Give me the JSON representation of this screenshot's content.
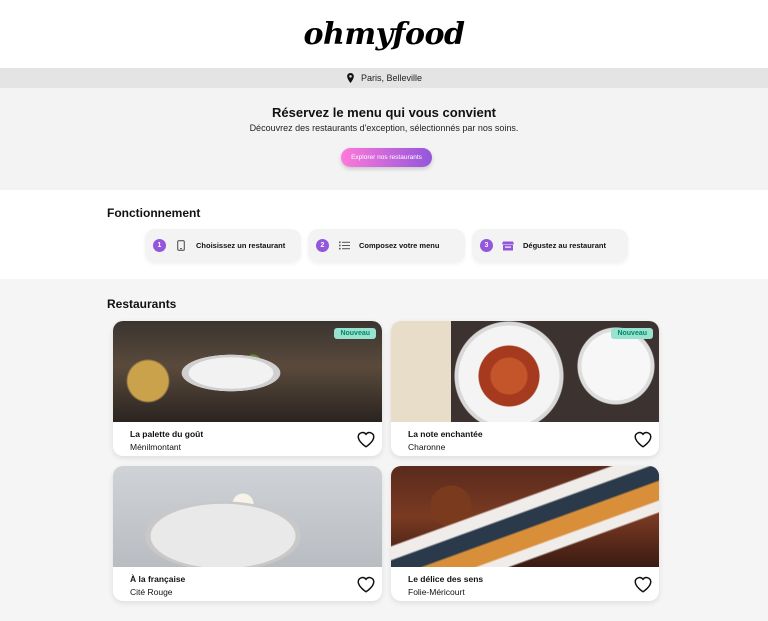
{
  "header": {
    "logo_text": "ohmyfood"
  },
  "location": {
    "icon": "map-pin-icon",
    "text": "Paris, Belleville"
  },
  "hero": {
    "title": "Réservez le menu qui vous convient",
    "subtitle": "Découvrez des restaurants d'exception, sélectionnés par nos soins.",
    "button_label": "Explorer nos restaurants",
    "button_colors": [
      "#ff79da",
      "#9356dc"
    ]
  },
  "how_it_works": {
    "title": "Fonctionnement",
    "steps": [
      {
        "number": "1",
        "icon": "phone-icon",
        "label": "Choisissez un restaurant"
      },
      {
        "number": "2",
        "icon": "list-icon",
        "label": "Composez votre menu"
      },
      {
        "number": "3",
        "icon": "store-icon",
        "label": "Dégustez au restaurant"
      }
    ],
    "accent_color": "#9356dc"
  },
  "restaurants": {
    "title": "Restaurants",
    "cards": [
      {
        "name": "La palette du goût",
        "area": "Ménilmontant",
        "badge": "Nouveau"
      },
      {
        "name": "La note enchantée",
        "area": "Charonne",
        "badge": "Nouveau"
      },
      {
        "name": "À la française",
        "area": "Cité Rouge",
        "badge": ""
      },
      {
        "name": "Le délice des sens",
        "area": "Folie-Méricourt",
        "badge": ""
      }
    ],
    "badge_color": "#99e2d0"
  }
}
